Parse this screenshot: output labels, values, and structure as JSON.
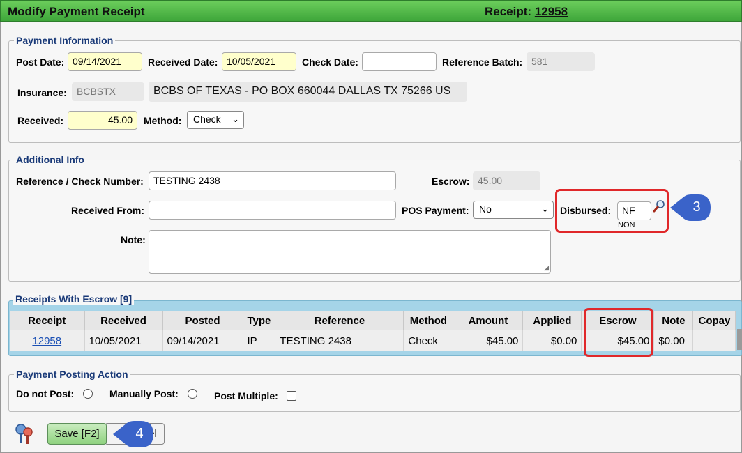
{
  "window": {
    "title": "Modify Payment Receipt",
    "receipt_label": "Receipt:",
    "receipt_number": "12958"
  },
  "payment_info": {
    "legend": "Payment Information",
    "post_date_label": "Post Date:",
    "post_date": "09/14/2021",
    "received_date_label": "Received Date:",
    "received_date": "10/05/2021",
    "check_date_label": "Check Date:",
    "check_date": "",
    "reference_batch_label": "Reference Batch:",
    "reference_batch": "581",
    "insurance_label": "Insurance:",
    "insurance_code": "BCBSTX",
    "insurance_name": "BCBS OF TEXAS - PO BOX 660044 DALLAS TX 75266 US",
    "received_label": "Received:",
    "received_amount": "45.00",
    "method_label": "Method:",
    "method": "Check"
  },
  "additional_info": {
    "legend": "Additional Info",
    "ref_check_label": "Reference / Check Number:",
    "ref_check": "TESTING 2438",
    "escrow_label": "Escrow:",
    "escrow": "45.00",
    "received_from_label": "Received From:",
    "received_from": "",
    "pos_payment_label": "POS Payment:",
    "pos_payment": "No",
    "disbursed_label": "Disbursed:",
    "disbursed_code": "NF",
    "disbursed_desc": "NON",
    "note_label": "Note:",
    "note": ""
  },
  "receipts_grid": {
    "legend": "Receipts With Escrow [9]",
    "columns": [
      "Receipt",
      "Received",
      "Posted",
      "Type",
      "Reference",
      "Method",
      "Amount",
      "Applied",
      "Escrow",
      "Note",
      "Copay"
    ],
    "rows": [
      [
        "12958",
        "10/05/2021",
        "09/14/2021",
        "IP",
        "TESTING 2438",
        "Check",
        "$45.00",
        "$0.00",
        "$45.00",
        "$0.00",
        ""
      ]
    ]
  },
  "posting_action": {
    "legend": "Payment Posting Action",
    "do_not_post_label": "Do not Post:",
    "manually_post_label": "Manually Post:",
    "post_multiple_label": "Post Multiple:"
  },
  "buttons": {
    "save": "Save [F2]",
    "cancel_visible": "el"
  },
  "callouts": {
    "disbursed": "3",
    "save": "4"
  },
  "colors": {
    "title_bar": "#3ea63a",
    "highlight": "#e0282a",
    "callout": "#3a63c9",
    "grid_border": "#a5d4e8"
  },
  "icons": {
    "lookup": "magnifier-icon",
    "keys": "keys-icon"
  }
}
